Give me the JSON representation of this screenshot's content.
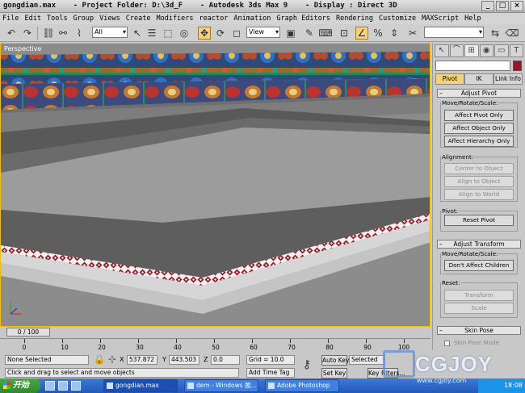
{
  "title_bar": {
    "title": "gongdian.max    - Project Folder: D:\\3d_F    - Autodesk 3ds Max 9    - Display : Direct 3D"
  },
  "menu": [
    "File",
    "Edit",
    "Tools",
    "Group",
    "Views",
    "Create",
    "Modifiers",
    "reactor",
    "Animation",
    "Graph Editors",
    "Rendering",
    "Customize",
    "MAXScript",
    "Help"
  ],
  "toolbar": {
    "selection_filter": "All",
    "reference_coord": "View"
  },
  "viewport": {
    "label": "Perspective"
  },
  "command_panel": {
    "tabs": [
      "Pivot",
      "IK",
      "Link Info"
    ],
    "adjust_pivot": {
      "title": "Adjust Pivot",
      "move_group_label": "Move/Rotate/Scale:",
      "buttons": [
        "Affect Pivot Only",
        "Affect Object Only",
        "Affect Hierarchy Only"
      ],
      "alignment_label": "Alignment:",
      "alignment_buttons": [
        "Center to Object",
        "Align to Object",
        "Align to World"
      ],
      "pivot_label": "Pivot:",
      "reset_pivot": "Reset Pivot"
    },
    "adjust_transform": {
      "title": "Adjust Transform",
      "move_group_label": "Move/Rotate/Scale:",
      "dont_affect_children": "Don't Affect Children",
      "reset_label": "Reset:",
      "reset_buttons": [
        "Transform",
        "Scale"
      ]
    },
    "skin_pose": {
      "title": "Skin Pose",
      "skin_pose_mode": "Skin Pose Mode"
    }
  },
  "timeline": {
    "slider_label": "0 / 100",
    "ticks": [
      "0",
      "10",
      "20",
      "30",
      "40",
      "50",
      "60",
      "70",
      "80",
      "90",
      "100"
    ]
  },
  "status": {
    "selection": "None Selected",
    "prompt": "Click and drag to select and move objects",
    "x_label": "X",
    "x_value": "537.872",
    "y_label": "Y",
    "y_value": "443.503",
    "z_label": "Z",
    "z_value": "0.0",
    "grid": "Grid = 10.0",
    "add_time_tag": "Add Time Tag",
    "auto_key": "Auto Key",
    "set_key": "Set Key",
    "key_mode": "Selected",
    "key_filters": "Key Filters..."
  },
  "taskbar": {
    "start": "开始",
    "tasks": [
      "gongdian.max",
      "dem - Windows 图...",
      "Adobe Photoshop"
    ],
    "clock": "18:08"
  },
  "watermark": {
    "logo_text": "CGJOY",
    "site": "www.cgjoy.com"
  }
}
